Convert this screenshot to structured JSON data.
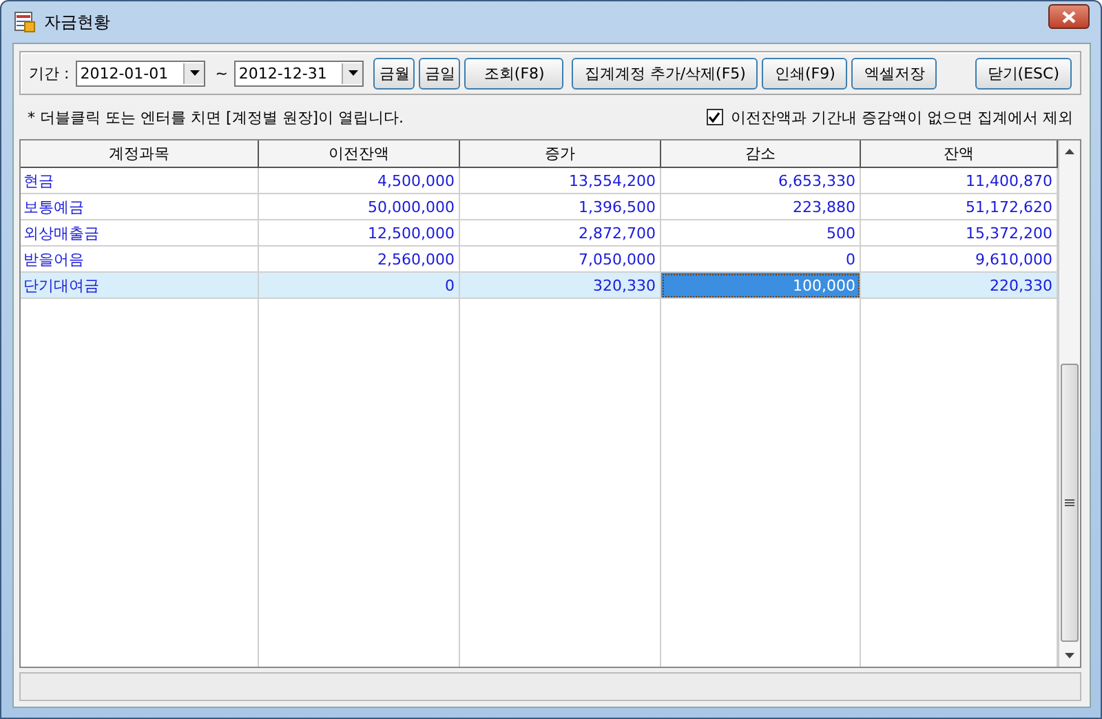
{
  "window": {
    "title": "자금현황"
  },
  "toolbar": {
    "period_label": "기간 :",
    "date_from": "2012-01-01",
    "separator": "~",
    "date_to": "2012-12-31",
    "buttons": [
      "금월",
      "금일",
      "조회(F8)",
      "집계계정 추가/삭제(F5)",
      "인쇄(F9)",
      "엑셀저장"
    ],
    "close_button": "닫기(ESC)"
  },
  "hint": "* 더블클릭 또는 엔터를 치면 [계정별 원장]이 열립니다.",
  "exclude_option": {
    "label": "이전잔액과 기간내 증감액이 없으면 집계에서 제외",
    "checked": true
  },
  "table": {
    "columns": [
      "계정과목",
      "이전잔액",
      "증가",
      "감소",
      "잔액"
    ],
    "rows": [
      {
        "selected": false,
        "cells": [
          {
            "text": "현금",
            "focused": false
          },
          {
            "text": "4,500,000",
            "focused": false
          },
          {
            "text": "13,554,200",
            "focused": false
          },
          {
            "text": "6,653,330",
            "focused": false
          },
          {
            "text": "11,400,870",
            "focused": false
          }
        ]
      },
      {
        "selected": false,
        "cells": [
          {
            "text": "보통예금",
            "focused": false
          },
          {
            "text": "50,000,000",
            "focused": false
          },
          {
            "text": "1,396,500",
            "focused": false
          },
          {
            "text": "223,880",
            "focused": false
          },
          {
            "text": "51,172,620",
            "focused": false
          }
        ]
      },
      {
        "selected": false,
        "cells": [
          {
            "text": "외상매출금",
            "focused": false
          },
          {
            "text": "12,500,000",
            "focused": false
          },
          {
            "text": "2,872,700",
            "focused": false
          },
          {
            "text": "500",
            "focused": false
          },
          {
            "text": "15,372,200",
            "focused": false
          }
        ]
      },
      {
        "selected": false,
        "cells": [
          {
            "text": "받을어음",
            "focused": false
          },
          {
            "text": "2,560,000",
            "focused": false
          },
          {
            "text": "7,050,000",
            "focused": false
          },
          {
            "text": "0",
            "focused": false
          },
          {
            "text": "9,610,000",
            "focused": false
          }
        ]
      },
      {
        "selected": true,
        "cells": [
          {
            "text": "단기대여금",
            "focused": false
          },
          {
            "text": "0",
            "focused": false
          },
          {
            "text": "320,330",
            "focused": false
          },
          {
            "text": "100,000",
            "focused": true
          },
          {
            "text": "220,330",
            "focused": false
          }
        ]
      }
    ]
  }
}
